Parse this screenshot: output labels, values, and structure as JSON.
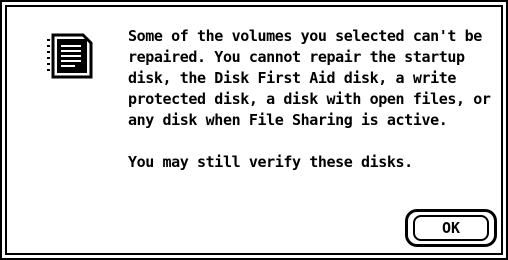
{
  "dialog": {
    "icon": "document-page-icon",
    "message_paragraph_1": "Some of the volumes you selected can't be repaired.  You cannot repair the startup disk, the Disk First Aid disk, a write protected disk, a disk with open files, or any disk when File Sharing is active.",
    "message_paragraph_2": "You may still verify these disks.",
    "ok_label": "OK"
  }
}
